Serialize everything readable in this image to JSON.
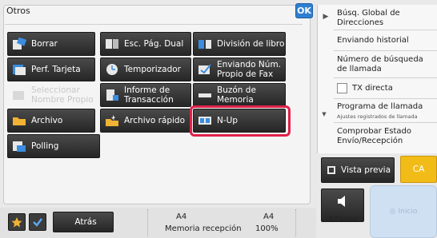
{
  "panel": {
    "title": "Otros",
    "ok_label": "OK",
    "buttons": [
      {
        "label": "Borrar",
        "icon": "eraser-icon",
        "enabled": true
      },
      {
        "label": "Esc. Pág. Dual",
        "icon": "dual-page-icon",
        "enabled": true
      },
      {
        "label": "División de libro",
        "icon": "book-divide-icon",
        "enabled": true
      },
      {
        "label": "Perf. Tarjeta",
        "icon": "card-icon",
        "enabled": true
      },
      {
        "label": "Temporizador",
        "icon": "clock-icon",
        "enabled": true
      },
      {
        "label": "Enviando Núm.\nPropio de Fax",
        "icon": "fax-number-icon",
        "enabled": true
      },
      {
        "label": "Seleccionar\nNombre Propio",
        "icon": "name-select-icon",
        "enabled": false
      },
      {
        "label": "Informe de\nTransacción",
        "icon": "report-icon",
        "enabled": true
      },
      {
        "label": "Buzón de Memoria",
        "icon": "mailbox-icon",
        "enabled": true
      },
      {
        "label": "Archivo",
        "icon": "folder-icon",
        "enabled": true
      },
      {
        "label": "Archivo rápido",
        "icon": "quick-file-icon",
        "enabled": true
      },
      {
        "label": "N-Up",
        "icon": "n-up-icon",
        "enabled": true
      },
      {
        "label": "Polling",
        "icon": "polling-icon",
        "enabled": true
      }
    ]
  },
  "side": {
    "global_search": "Búsq. Global de Direcciones",
    "history": "Enviando historial",
    "search_number": "Número de búsqueda\nde llamada",
    "direct_tx": "TX directa",
    "program_label": "Programa de llamada",
    "program_sub": "Ajustes registrados de llamada",
    "check_status": "Comprobar Estado\nEnvío/Recepción"
  },
  "actions": {
    "preview": "Vista previa",
    "ca": "CA",
    "speaker": "Altavoz",
    "start": "Inicio"
  },
  "bottom": {
    "back": "Atrás",
    "paper_a": "A4",
    "paper_b": "A4",
    "memory_label": "Memoria recepción",
    "memory_pct": "100%"
  },
  "colors": {
    "accent_ok": "#2f7fd1",
    "ca": "#f2bc18",
    "highlight": "#e0204a",
    "button_dark": "#2e2e2e"
  }
}
